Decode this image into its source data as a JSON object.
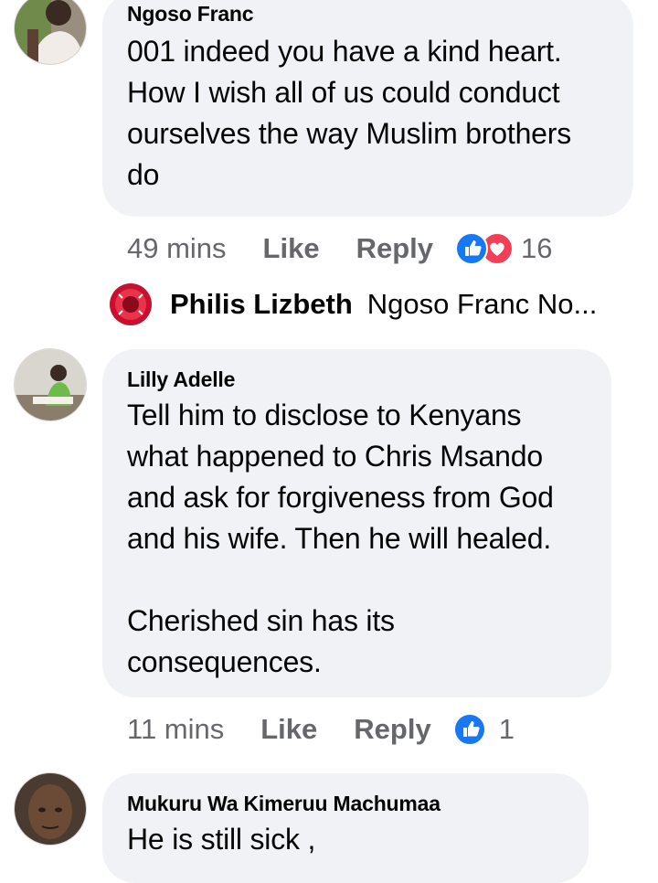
{
  "comments": [
    {
      "author": "Ngoso Franc",
      "text": "001 indeed you have a kind heart. How I wish all of us could conduct ourselves the way Muslim brothers do",
      "time": "49 mins",
      "like_label": "Like",
      "reply_label": "Reply",
      "reaction_count": "16",
      "reactions": [
        "like-icon",
        "love-icon"
      ]
    },
    {
      "author": "Lilly Adelle",
      "text": "Tell him to disclose to Kenyans what happened to Chris Msando and ask for forgiveness from God and his wife. Then he will healed.\n\nCherished sin has its consequences.",
      "time": "11 mins",
      "like_label": "Like",
      "reply_label": "Reply",
      "reaction_count": "1",
      "reactions": [
        "like-icon"
      ]
    },
    {
      "author": "Mukuru Wa Kimeruu Machumaa",
      "text": "He is still sick ,"
    }
  ],
  "reply_preview": {
    "author": "Philis Lizbeth",
    "text": "Ngoso Franc No..."
  },
  "colors": {
    "bubble": "#f0f2f5",
    "meta_text": "#65676b",
    "like_blue": "#1877f2",
    "love_red": "#f33e58"
  }
}
